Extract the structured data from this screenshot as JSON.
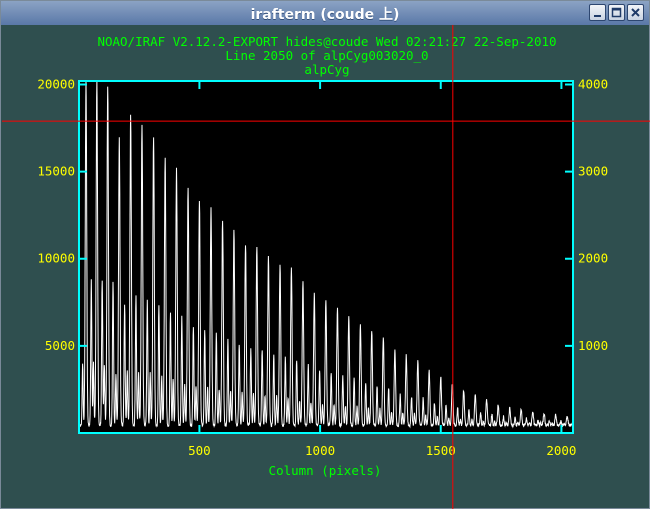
{
  "window": {
    "title": "irafterm (coude 上)",
    "buttons": [
      "minimize",
      "maximize",
      "close"
    ]
  },
  "plot_header": {
    "line1": "NOAO/IRAF V2.12.2-EXPORT hides@coude Wed 02:21:27 22-Sep-2010",
    "line2": "Line 2050 of alpCyg003020_0",
    "line3": "alpCyg"
  },
  "colors": {
    "background": "#2f4f4f",
    "frame": "#00ffff",
    "header_text": "#00ff00",
    "tick_labels": "#ffff00",
    "data": "#ffffff",
    "cursor": "#ff0000",
    "plot_bg": "#000000"
  },
  "chart_data": {
    "type": "line",
    "title": "Line 2050 of alpCyg003020_0",
    "xlabel": "Column (pixels)",
    "ylabel": "",
    "xlim": [
      1,
      2048
    ],
    "ylim": [
      0,
      20200
    ],
    "x_ticks": [
      "500",
      "1000",
      "1500",
      "2000"
    ],
    "y_left_ticks": [
      "5000",
      "10000",
      "15000",
      "20000"
    ],
    "y_right_ticks": [
      "1000",
      "2000",
      "3000",
      "4000"
    ],
    "grid": false,
    "series": [
      {
        "peaks": {
          "x": [
            30,
            75,
            120,
            168,
            215,
            262,
            310,
            358,
            405,
            453,
            500,
            548,
            596,
            643,
            691,
            738,
            786,
            834,
            881,
            929,
            976,
            1024,
            1072,
            1119,
            1167,
            1214,
            1262,
            1310,
            1357,
            1405,
            1452,
            1500,
            1548,
            1595,
            1643,
            1690,
            1738,
            1786,
            1833,
            1881,
            1928,
            1976,
            2024
          ],
          "y": [
            19900,
            19800,
            19500,
            16500,
            17800,
            17200,
            16500,
            15400,
            14800,
            13600,
            12900,
            12500,
            11800,
            11200,
            10400,
            10300,
            9700,
            9200,
            9000,
            8200,
            7600,
            7100,
            6700,
            6300,
            5800,
            5400,
            5100,
            4300,
            4000,
            3700,
            3100,
            2800,
            2400,
            2000,
            1800,
            1500,
            1200,
            1000,
            900,
            800,
            700,
            600,
            500
          ]
        }
      }
    ]
  },
  "cursor": {
    "x_value": 1550,
    "y_value": 17900
  }
}
